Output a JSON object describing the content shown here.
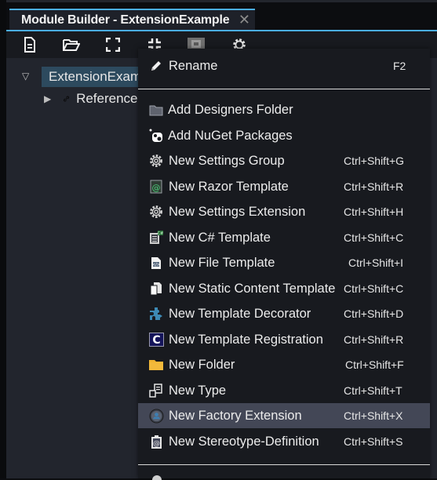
{
  "window": {
    "tab_title": "Module Builder - ExtensionExample",
    "close_icon": "close-icon"
  },
  "toolbar": {
    "buttons": [
      {
        "name": "new-file",
        "icon": "document-icon"
      },
      {
        "name": "open",
        "icon": "folder-open-icon"
      },
      {
        "name": "expand-all",
        "icon": "expand-icon"
      },
      {
        "name": "collapse-all",
        "icon": "collapse-icon"
      },
      {
        "name": "package",
        "icon": "package-icon"
      },
      {
        "name": "settings",
        "icon": "gear-icon"
      }
    ]
  },
  "tree": {
    "items": [
      {
        "label": "ExtensionExample",
        "icon": "module-icon",
        "expanded": true,
        "selected": true
      },
      {
        "label": "References",
        "icon": "link-icon",
        "expanded": false,
        "selected": false
      }
    ]
  },
  "context_menu": {
    "items": [
      {
        "label": "Rename",
        "shortcut": "F2",
        "icon": "pencil-icon"
      },
      {
        "label": "Add Designers Folder",
        "shortcut": "",
        "icon": "folder-icon"
      },
      {
        "label": "Add NuGet Packages",
        "shortcut": "",
        "icon": "nuget-icon"
      },
      {
        "label": "New Settings Group",
        "shortcut": "Ctrl+Shift+G",
        "icon": "gear-icon"
      },
      {
        "label": "New Razor Template",
        "shortcut": "Ctrl+Shift+R",
        "icon": "razor-template-icon"
      },
      {
        "label": "New Settings Extension",
        "shortcut": "Ctrl+Shift+H",
        "icon": "gear-icon"
      },
      {
        "label": "New C# Template",
        "shortcut": "Ctrl+Shift+C",
        "icon": "csharp-template-icon"
      },
      {
        "label": "New File Template",
        "shortcut": "Ctrl+Shift+I",
        "icon": "file-template-icon"
      },
      {
        "label": "New Static Content Template",
        "shortcut": "Ctrl+Shift+C",
        "icon": "static-content-icon"
      },
      {
        "label": "New Template Decorator",
        "shortcut": "Ctrl+Shift+D",
        "icon": "puzzle-icon"
      },
      {
        "label": "New Template Registration",
        "shortcut": "Ctrl+Shift+R",
        "icon": "registration-c-icon"
      },
      {
        "label": "New Folder",
        "shortcut": "Ctrl+Shift+F",
        "icon": "yellow-folder-icon"
      },
      {
        "label": "New Type",
        "shortcut": "Ctrl+Shift+T",
        "icon": "type-icon"
      },
      {
        "label": "New Factory Extension",
        "shortcut": "Ctrl+Shift+X",
        "icon": "factory-extension-icon",
        "highlighted": true
      },
      {
        "label": "New Stereotype-Definition",
        "shortcut": "Ctrl+Shift+S",
        "icon": "stereotype-icon"
      }
    ]
  }
}
